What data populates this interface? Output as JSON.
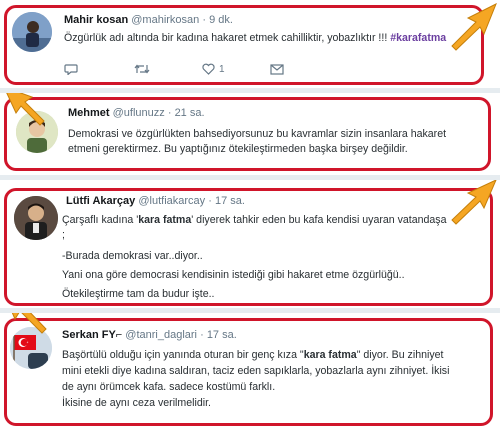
{
  "colors": {
    "highlight_border": "#d0152a",
    "arrow_fill": "#f5a623",
    "hashtag": "#6b3fa0"
  },
  "tweets": [
    {
      "name": "Mahir kosan",
      "handle": "@mahirkosan",
      "sep": "·",
      "time": "9 dk.",
      "lines": [
        "Özgürlük adı altında bir kadına hakaret etmek cahilliktir, yobazlıktır !!!"
      ],
      "hashtag": "#karafatma",
      "reply_icon": "reply-icon",
      "retweet_icon": "retweet-icon",
      "like_icon": "heart-icon",
      "like_count": "1",
      "dm_icon": "envelope-icon"
    },
    {
      "name": "Mehmet",
      "handle": "@uflunuzz",
      "sep": "·",
      "time": "21 sa.",
      "lines": [
        "Demokrasi ve özgürlükten bahsediyorsunuz bu kavramlar sizin insanlara hakaret",
        "etmeni gerektirmez. Bu yaptığınız ötekileştirmeden başka birşey değildir."
      ]
    },
    {
      "name": "Lütfi Akarçay",
      "handle": "@lutfiakarcay",
      "sep": "·",
      "time": "17 sa.",
      "line1_pre": "Çarşaflı kadına '",
      "line1_bold": "kara fatma",
      "line1_post": "' diyerek tahkir eden bu kafa kendisi uyaran vatandaşa",
      "lines": [
        ";",
        "-Burada demokrasi var..diyor..",
        "Yani ona göre democrasi kendisinin istediği gibi hakaret etme özgürlüğü..",
        "Ötekileştirme tam da budur işte.."
      ]
    },
    {
      "name": "Serkan FY⌐",
      "handle": "@tanri_daglari",
      "sep": "·",
      "time": "17 sa.",
      "line1_pre": "Başörtülü olduğu için yanında oturan bir genç kıza \"",
      "line1_bold": "kara fatma",
      "line1_post": "\" diyor. Bu zihniyet",
      "lines": [
        "mini etekli diye kadına saldıran, taciz eden sapıklarla, yobazlarla aynı zihniyet. İkisi",
        "de aynı örümcek kafa. sadece kostümü farklı.",
        "İkisine de aynı ceza verilmelidir."
      ]
    }
  ]
}
